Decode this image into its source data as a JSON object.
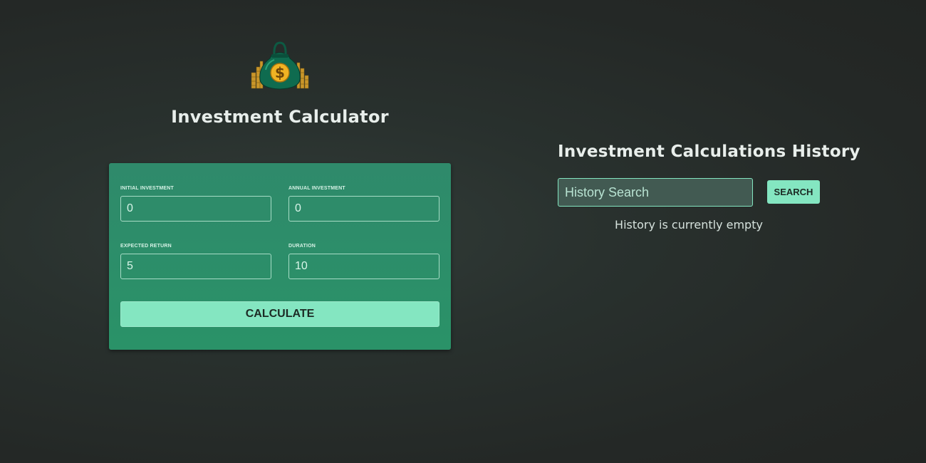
{
  "app": {
    "logo_icon": "money-bag-icon",
    "title": "Investment Calculator"
  },
  "calculator": {
    "fields": {
      "initial_investment": {
        "label": "INITIAL INVESTMENT",
        "value": "0"
      },
      "annual_investment": {
        "label": "ANNUAL INVESTMENT",
        "value": "0"
      },
      "expected_return": {
        "label": "EXPECTED RETURN",
        "value": "5"
      },
      "duration": {
        "label": "DURATION",
        "value": "10"
      }
    },
    "calculate_label": "CALCULATE"
  },
  "history": {
    "title": "Investment Calculations History",
    "search_placeholder": "History Search",
    "search_label": "SEARCH",
    "empty_message": "History is currently empty"
  },
  "colors": {
    "background": "#262b29",
    "card": "#2e8c6a",
    "accent": "#84e6c1",
    "text": "#e8eeeb"
  }
}
